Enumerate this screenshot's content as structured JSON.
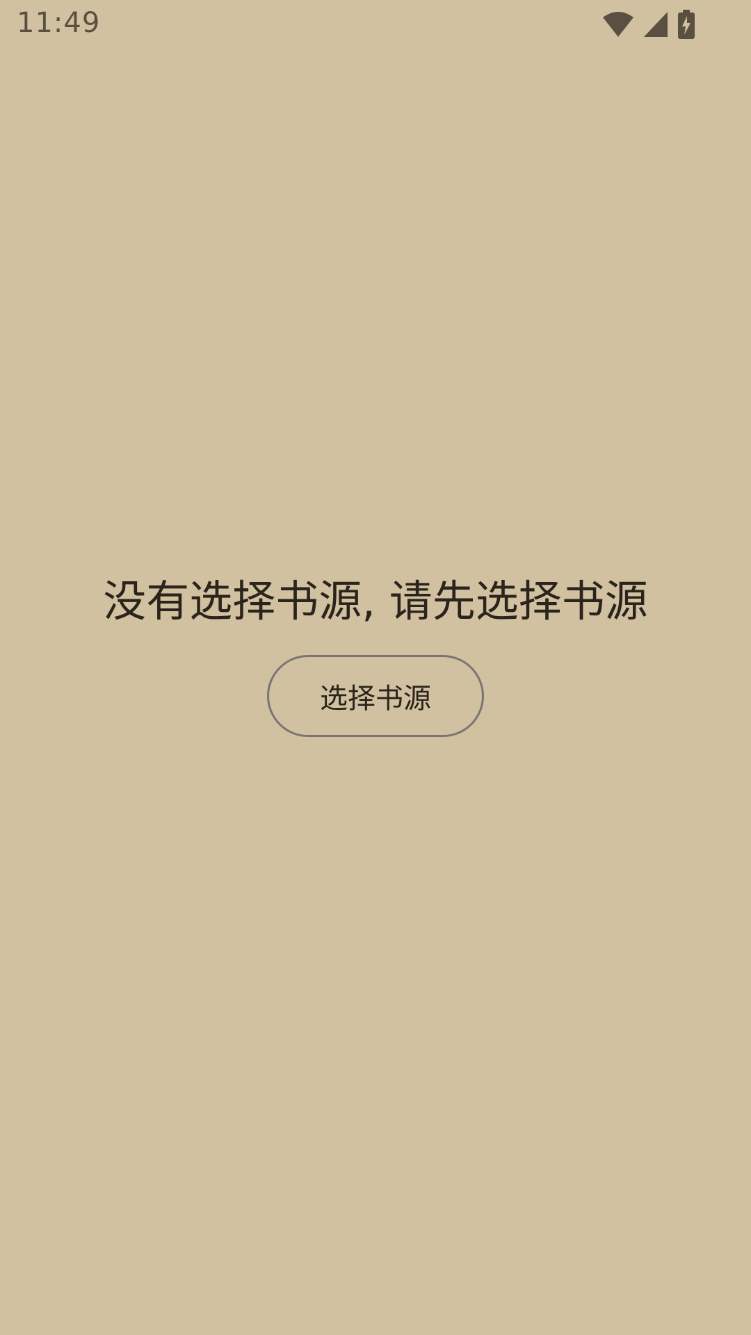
{
  "status_bar": {
    "time": "11:49",
    "icons": [
      "wifi-icon",
      "signal-icon",
      "battery-charging-icon"
    ]
  },
  "empty_state": {
    "message": "没有选择书源, 请先选择书源",
    "button_label": "选择书源"
  },
  "colors": {
    "background": "#d2c1a0",
    "status_icon": "#5a5042",
    "text": "#2a241c",
    "button_border": "#7a7570"
  }
}
